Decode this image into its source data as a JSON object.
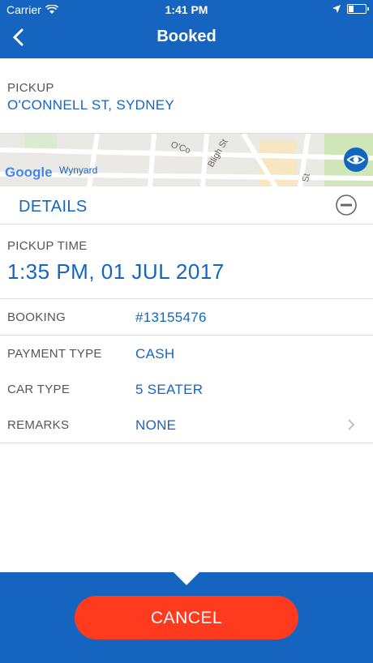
{
  "status": {
    "carrier": "Carrier",
    "time": "1:41 PM"
  },
  "header": {
    "title": "Booked"
  },
  "pickup": {
    "label": "PICKUP",
    "address": "O'CONNELL ST, SYDNEY"
  },
  "map": {
    "google_text": "Google",
    "place_label": "Wynyard",
    "street_labels": [
      "O'Co",
      "Bligh St",
      "St"
    ]
  },
  "details": {
    "title": "DETAILS",
    "pickup_time_label": "PICKUP TIME",
    "pickup_time_value": "1:35 PM, 01 JUL 2017",
    "rows": [
      {
        "key": "BOOKING",
        "value": "#13155476"
      },
      {
        "key": "PAYMENT TYPE",
        "value": "CASH"
      },
      {
        "key": "CAR TYPE",
        "value": "5 SEATER"
      },
      {
        "key": "REMARKS",
        "value": "NONE"
      }
    ]
  },
  "footer": {
    "cancel_label": "CANCEL"
  },
  "colors": {
    "brand": "#1565c0",
    "cancel": "#ff3b1f"
  }
}
